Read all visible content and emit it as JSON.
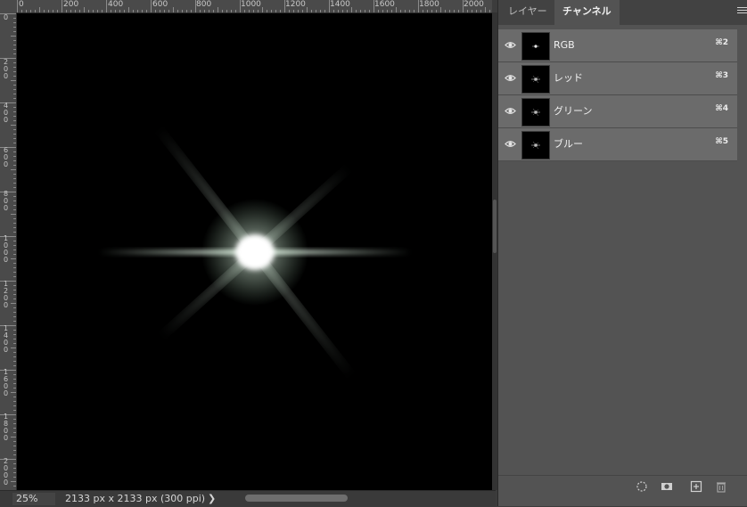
{
  "ruler": {
    "horizontal_labels": [
      "0",
      "200",
      "400",
      "600",
      "800",
      "1000",
      "1200",
      "1400",
      "1600",
      "1800",
      "2000"
    ],
    "vertical_labels": [
      "0",
      "200",
      "400",
      "600",
      "800",
      "1000",
      "1200",
      "1400",
      "1600",
      "1800",
      "2000"
    ]
  },
  "status_bar": {
    "zoom": "25%",
    "doc_size": "2133 px x 2133 px (300 ppi)",
    "arrow": "❯"
  },
  "panel": {
    "tabs": [
      {
        "label": "レイヤー",
        "active": false
      },
      {
        "label": "チャンネル",
        "active": true
      }
    ],
    "channels": [
      {
        "name": "RGB",
        "shortcut": "⌘2",
        "visible": true
      },
      {
        "name": "レッド",
        "shortcut": "⌘3",
        "visible": true
      },
      {
        "name": "グリーン",
        "shortcut": "⌘4",
        "visible": true
      },
      {
        "name": "ブルー",
        "shortcut": "⌘5",
        "visible": true
      }
    ],
    "footer_icons": [
      "load-selection-icon",
      "save-selection-icon",
      "new-channel-icon",
      "delete-icon"
    ]
  },
  "colors": {
    "canvas_bg": "#000000",
    "flare_core": "#ffffff",
    "flare_tint": "#cfe8d4"
  }
}
